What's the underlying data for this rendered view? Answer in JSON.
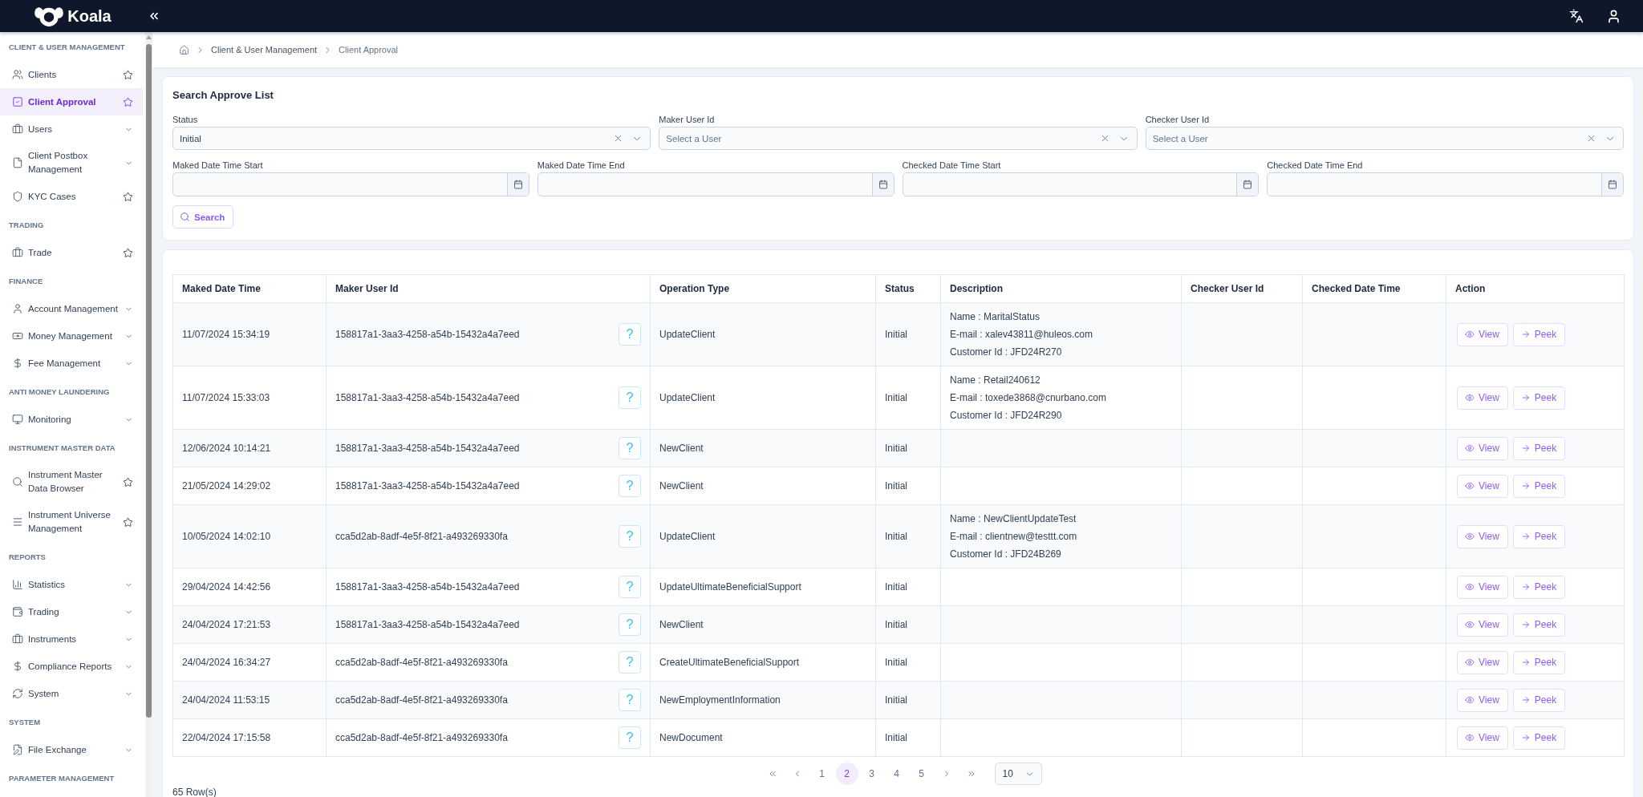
{
  "header": {
    "logo_text": "Koala"
  },
  "sidebar": {
    "sections": [
      {
        "title": "CLIENT & USER MANAGEMENT",
        "items": [
          {
            "label": "Clients",
            "kind": "link",
            "selected": false
          },
          {
            "label": "Client Approval",
            "kind": "link",
            "selected": true
          },
          {
            "label": "Users",
            "kind": "group",
            "selected": false
          },
          {
            "label": "Client Postbox Management",
            "kind": "group",
            "selected": false
          },
          {
            "label": "KYC Cases",
            "kind": "link",
            "selected": false
          }
        ]
      },
      {
        "title": "TRADING",
        "items": [
          {
            "label": "Trade",
            "kind": "link",
            "selected": false
          }
        ]
      },
      {
        "title": "FINANCE",
        "items": [
          {
            "label": "Account Management",
            "kind": "group",
            "selected": false
          },
          {
            "label": "Money Management",
            "kind": "group",
            "selected": false
          },
          {
            "label": "Fee Management",
            "kind": "group",
            "selected": false
          }
        ]
      },
      {
        "title": "ANTI MONEY LAUNDERING",
        "items": [
          {
            "label": "Monitoring",
            "kind": "group",
            "selected": false
          }
        ]
      },
      {
        "title": "INSTRUMENT MASTER DATA",
        "items": [
          {
            "label": "Instrument Master Data Browser",
            "kind": "link",
            "selected": false
          },
          {
            "label": "Instrument Universe Management",
            "kind": "link",
            "selected": false
          }
        ]
      },
      {
        "title": "REPORTS",
        "items": [
          {
            "label": "Statistics",
            "kind": "group",
            "selected": false
          },
          {
            "label": "Trading",
            "kind": "group",
            "selected": false
          },
          {
            "label": "Instruments",
            "kind": "group",
            "selected": false
          },
          {
            "label": "Compliance Reports",
            "kind": "group",
            "selected": false
          },
          {
            "label": "System",
            "kind": "group",
            "selected": false
          }
        ]
      },
      {
        "title": "SYSTEM",
        "items": [
          {
            "label": "File Exchange",
            "kind": "group",
            "selected": false
          }
        ]
      },
      {
        "title": "PARAMETER MANAGEMENT"
      }
    ]
  },
  "breadcrumb": [
    "Client & User Management",
    "Client Approval"
  ],
  "search_panel": {
    "title": "Search Approve List",
    "rows": [
      [
        {
          "label": "Status",
          "kind": "select",
          "value": "Initial"
        },
        {
          "label": "Maker User Id",
          "kind": "select",
          "placeholder": "Select a User"
        },
        {
          "label": "Checker User Id",
          "kind": "select",
          "placeholder": "Select a User"
        }
      ],
      [
        {
          "label": "Maked Date Time Start",
          "kind": "date"
        },
        {
          "label": "Maked Date Time End",
          "kind": "date"
        },
        {
          "label": "Checked Date Time Start",
          "kind": "date"
        },
        {
          "label": "Checked Date Time End",
          "kind": "date"
        }
      ]
    ],
    "button": "Search"
  },
  "table": {
    "columns": [
      "Maked Date Time",
      "Maker User Id",
      "Operation Type",
      "Status",
      "Description",
      "Checker User Id",
      "Checked Date Time",
      "Action"
    ],
    "rows": [
      {
        "maked_date_time": "11/07/2024 15:34:19",
        "maker_user_id": "158817a1-3aa3-4258-a54b-15432a4a7eed",
        "help": "?",
        "operation_type": "UpdateClient",
        "status": "Initial",
        "description": [
          "Name : MaritalStatus",
          "E-mail : xalev43811@huleos.com",
          "Customer Id : JFD24R270"
        ],
        "actions": [
          "View",
          "Peek"
        ]
      },
      {
        "maked_date_time": "11/07/2024 15:33:03",
        "maker_user_id": "158817a1-3aa3-4258-a54b-15432a4a7eed",
        "help": "?",
        "operation_type": "UpdateClient",
        "status": "Initial",
        "description": [
          "Name : Retail240612",
          "E-mail : toxede3868@cnurbano.com",
          "Customer Id : JFD24R290"
        ],
        "actions": [
          "View",
          "Peek"
        ]
      },
      {
        "maked_date_time": "12/06/2024 10:14:21",
        "maker_user_id": "158817a1-3aa3-4258-a54b-15432a4a7eed",
        "help": "?",
        "operation_type": "NewClient",
        "status": "Initial",
        "actions": [
          "View",
          "Peek"
        ]
      },
      {
        "maked_date_time": "21/05/2024 14:29:02",
        "maker_user_id": "158817a1-3aa3-4258-a54b-15432a4a7eed",
        "help": "?",
        "operation_type": "NewClient",
        "status": "Initial",
        "actions": [
          "View",
          "Peek"
        ]
      },
      {
        "maked_date_time": "10/05/2024 14:02:10",
        "maker_user_id": "cca5d2ab-8adf-4e5f-8f21-a493269330fa",
        "help": "?",
        "operation_type": "UpdateClient",
        "status": "Initial",
        "description": [
          "Name : NewClientUpdateTest",
          "E-mail : clientnew@testtt.com",
          "Customer Id : JFD24B269"
        ],
        "actions": [
          "View",
          "Peek"
        ]
      },
      {
        "maked_date_time": "29/04/2024 14:42:56",
        "maker_user_id": "158817a1-3aa3-4258-a54b-15432a4a7eed",
        "help": "?",
        "operation_type": "UpdateUltimateBeneficialSupport",
        "status": "Initial",
        "actions": [
          "View",
          "Peek"
        ]
      },
      {
        "maked_date_time": "24/04/2024 17:21:53",
        "maker_user_id": "158817a1-3aa3-4258-a54b-15432a4a7eed",
        "help": "?",
        "operation_type": "NewClient",
        "status": "Initial",
        "actions": [
          "View",
          "Peek"
        ]
      },
      {
        "maked_date_time": "24/04/2024 16:34:27",
        "maker_user_id": "cca5d2ab-8adf-4e5f-8f21-a493269330fa",
        "help": "?",
        "operation_type": "CreateUltimateBeneficialSupport",
        "status": "Initial",
        "actions": [
          "View",
          "Peek"
        ]
      },
      {
        "maked_date_time": "24/04/2024 11:53:15",
        "maker_user_id": "cca5d2ab-8adf-4e5f-8f21-a493269330fa",
        "help": "?",
        "operation_type": "NewEmploymentInformation",
        "status": "Initial",
        "actions": [
          "View",
          "Peek"
        ]
      },
      {
        "maked_date_time": "22/04/2024 17:15:58",
        "maker_user_id": "cca5d2ab-8adf-4e5f-8f21-a493269330fa",
        "help": "?",
        "operation_type": "NewDocument",
        "status": "Initial",
        "actions": [
          "View",
          "Peek"
        ]
      }
    ]
  },
  "pagination": {
    "pages": [
      {
        "label": "1",
        "selected": false
      },
      {
        "label": "2",
        "selected": true
      },
      {
        "label": "3",
        "selected": false
      },
      {
        "label": "4",
        "selected": false
      },
      {
        "label": "5",
        "selected": false
      }
    ],
    "page_size": "10"
  },
  "row_count": "65 Row(s)"
}
